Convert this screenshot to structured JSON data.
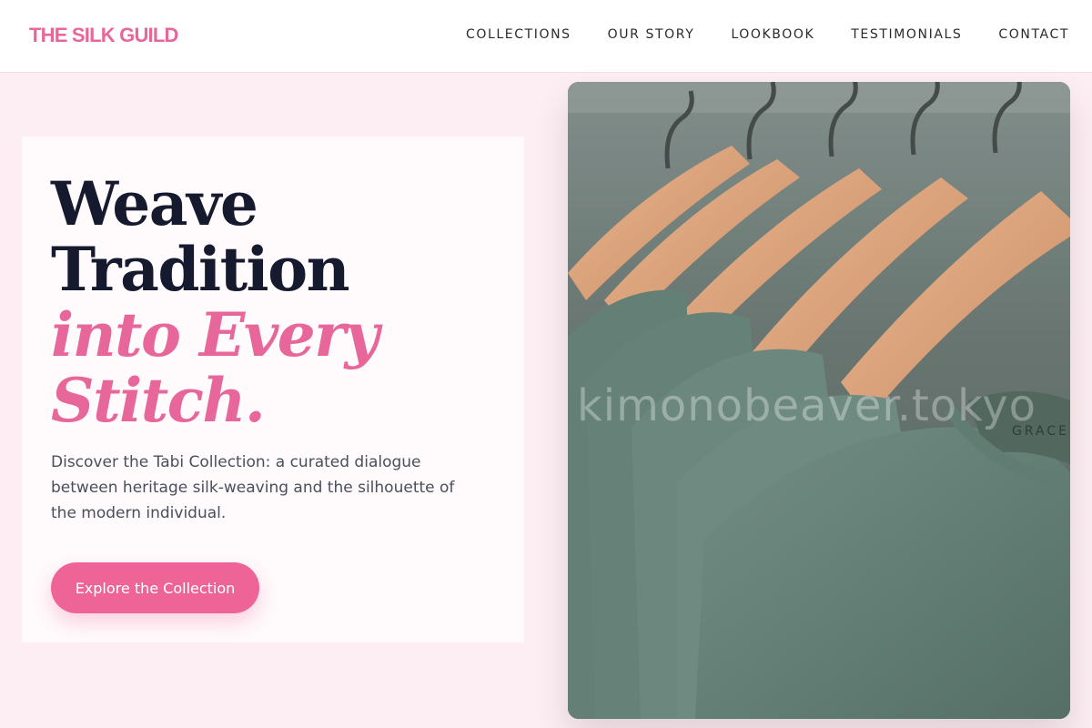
{
  "header": {
    "brand": "THE SILK GUILD",
    "nav": [
      {
        "label": "COLLECTIONS"
      },
      {
        "label": "OUR STORY"
      },
      {
        "label": "LOOKBOOK"
      },
      {
        "label": "TESTIMONIALS"
      },
      {
        "label": "CONTACT"
      }
    ]
  },
  "hero": {
    "headline_line1": "Weave",
    "headline_line2": "Tradition",
    "headline_accent_line1": "into Every",
    "headline_accent_line2": "Stitch.",
    "description": "Discover the Tabi Collection: a curated dialogue between heritage silk-weaving and the silhouette of the modern individual.",
    "cta_label": "Explore the Collection"
  },
  "photo": {
    "subject": "green t-shirts on wooden hangers",
    "watermark": "kimonobeaver.tokyo",
    "tag_brand": "GRACE"
  },
  "colors": {
    "accent": "#e8679a",
    "button": "#ef6497",
    "background": "#fdeef3",
    "heading": "#161a2e"
  }
}
